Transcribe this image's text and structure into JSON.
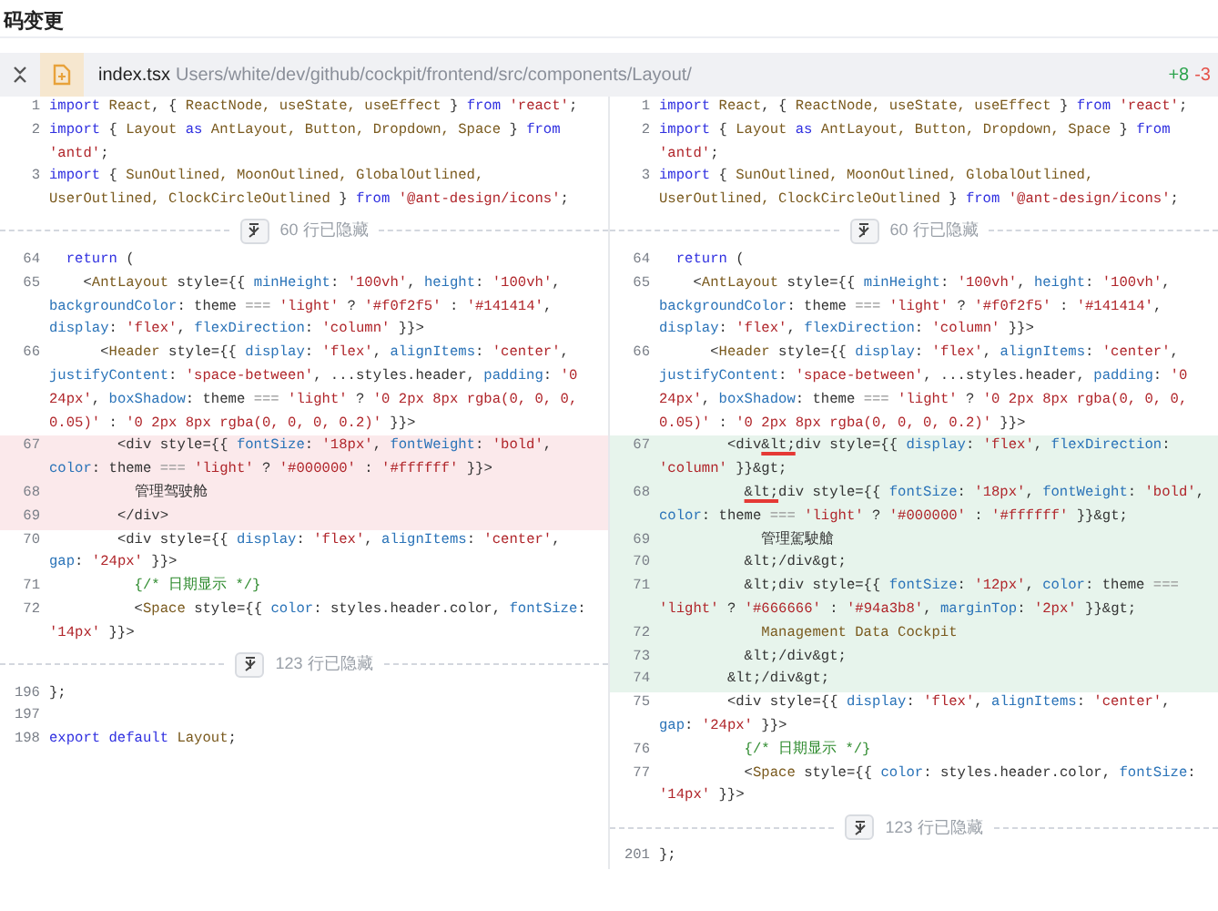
{
  "page_title": "码变更",
  "file": {
    "name": "index.tsx",
    "path": "Users/white/dev/github/cockpit/frontend/src/components/Layout/",
    "additions": "+8",
    "deletions": "-3"
  },
  "panes": [
    {
      "rows": [
        {
          "kind": "context",
          "number": "1",
          "segments": [
            {
              "kind": "kw",
              "text": "import "
            },
            {
              "kind": "type",
              "text": "React"
            },
            {
              "kind": "plain",
              "text": ", { "
            },
            {
              "kind": "type",
              "text": "ReactNode, useState, useEffect"
            },
            {
              "kind": "plain",
              "text": " } "
            },
            {
              "kind": "kw",
              "text": "from "
            },
            {
              "kind": "str",
              "text": "'react'"
            },
            {
              "kind": "plain",
              "text": ";"
            }
          ]
        },
        {
          "kind": "context",
          "number": "2",
          "segments": [
            {
              "kind": "kw",
              "text": "import"
            },
            {
              "kind": "plain",
              "text": " { "
            },
            {
              "kind": "type",
              "text": "Layout"
            },
            {
              "kind": "kw",
              "text": " as "
            },
            {
              "kind": "type",
              "text": "AntLayout, Button, Dropdown, Space"
            },
            {
              "kind": "plain",
              "text": " } "
            },
            {
              "kind": "kw",
              "text": "from "
            },
            {
              "kind": "str",
              "text": "'antd'"
            },
            {
              "kind": "plain",
              "text": ";"
            }
          ]
        },
        {
          "kind": "context",
          "number": "3",
          "segments": [
            {
              "kind": "kw",
              "text": "import"
            },
            {
              "kind": "plain",
              "text": " { "
            },
            {
              "kind": "type",
              "text": "SunOutlined, MoonOutlined, GlobalOutlined, UserOutlined, ClockCircleOutlined"
            },
            {
              "kind": "plain",
              "text": " } "
            },
            {
              "kind": "kw",
              "text": "from "
            },
            {
              "kind": "str",
              "text": "'@ant-design/icons'"
            },
            {
              "kind": "plain",
              "text": ";"
            }
          ]
        },
        {
          "kind": "fold",
          "text": "60 行已隐藏"
        },
        {
          "kind": "context",
          "number": "64",
          "segments": [
            {
              "kind": "kw",
              "text": "  return"
            },
            {
              "kind": "plain",
              "text": " ("
            }
          ]
        },
        {
          "kind": "context",
          "number": "65",
          "segments": [
            {
              "kind": "plain",
              "text": "    <"
            },
            {
              "kind": "type",
              "text": "AntLayout"
            },
            {
              "kind": "plain",
              "text": " style={{ "
            },
            {
              "kind": "prop",
              "text": "minHeight"
            },
            {
              "kind": "plain",
              "text": ": "
            },
            {
              "kind": "str",
              "text": "'100vh'"
            },
            {
              "kind": "plain",
              "text": ", "
            },
            {
              "kind": "prop",
              "text": "height"
            },
            {
              "kind": "plain",
              "text": ": "
            },
            {
              "kind": "str",
              "text": "'100vh'"
            },
            {
              "kind": "plain",
              "text": ", "
            },
            {
              "kind": "prop",
              "text": "backgroundColor"
            },
            {
              "kind": "plain",
              "text": ": theme "
            },
            {
              "kind": "op",
              "text": "=== "
            },
            {
              "kind": "str",
              "text": "'light'"
            },
            {
              "kind": "plain",
              "text": " ? "
            },
            {
              "kind": "str",
              "text": "'#f0f2f5'"
            },
            {
              "kind": "plain",
              "text": " : "
            },
            {
              "kind": "str",
              "text": "'#141414'"
            },
            {
              "kind": "plain",
              "text": ", "
            },
            {
              "kind": "prop",
              "text": "display"
            },
            {
              "kind": "plain",
              "text": ": "
            },
            {
              "kind": "str",
              "text": "'flex'"
            },
            {
              "kind": "plain",
              "text": ", "
            },
            {
              "kind": "prop",
              "text": "flexDirection"
            },
            {
              "kind": "plain",
              "text": ": "
            },
            {
              "kind": "str",
              "text": "'column'"
            },
            {
              "kind": "plain",
              "text": " }}>"
            }
          ]
        },
        {
          "kind": "context",
          "number": "66",
          "segments": [
            {
              "kind": "plain",
              "text": "      <"
            },
            {
              "kind": "type",
              "text": "Header"
            },
            {
              "kind": "plain",
              "text": " style={{ "
            },
            {
              "kind": "prop",
              "text": "display"
            },
            {
              "kind": "plain",
              "text": ": "
            },
            {
              "kind": "str",
              "text": "'flex'"
            },
            {
              "kind": "plain",
              "text": ", "
            },
            {
              "kind": "prop",
              "text": "alignItems"
            },
            {
              "kind": "plain",
              "text": ": "
            },
            {
              "kind": "str",
              "text": "'center'"
            },
            {
              "kind": "plain",
              "text": ", "
            },
            {
              "kind": "prop",
              "text": "justifyContent"
            },
            {
              "kind": "plain",
              "text": ": "
            },
            {
              "kind": "str",
              "text": "'space-between'"
            },
            {
              "kind": "plain",
              "text": ", ...styles.header, "
            },
            {
              "kind": "prop",
              "text": "padding"
            },
            {
              "kind": "plain",
              "text": ": "
            },
            {
              "kind": "str",
              "text": "'0 24px'"
            },
            {
              "kind": "plain",
              "text": ", "
            },
            {
              "kind": "prop",
              "text": "boxShadow"
            },
            {
              "kind": "plain",
              "text": ": theme "
            },
            {
              "kind": "op",
              "text": "=== "
            },
            {
              "kind": "str",
              "text": "'light'"
            },
            {
              "kind": "plain",
              "text": " ? "
            },
            {
              "kind": "str",
              "text": "'0 2px 8px rgba(0, 0, 0, 0.05)'"
            },
            {
              "kind": "plain",
              "text": " : "
            },
            {
              "kind": "str",
              "text": "'0 2px 8px rgba(0, 0, 0, 0.2)'"
            },
            {
              "kind": "plain",
              "text": " }}>"
            }
          ]
        },
        {
          "kind": "removed",
          "number": "67",
          "segments": [
            {
              "kind": "plain",
              "text": "        <div style={{ "
            },
            {
              "kind": "prop",
              "text": "fontSize"
            },
            {
              "kind": "plain",
              "text": ": "
            },
            {
              "kind": "str",
              "text": "'18px'"
            },
            {
              "kind": "plain",
              "text": ", "
            },
            {
              "kind": "prop",
              "text": "fontWeight"
            },
            {
              "kind": "plain",
              "text": ": "
            },
            {
              "kind": "str",
              "text": "'bold'"
            },
            {
              "kind": "plain",
              "text": ", "
            },
            {
              "kind": "prop",
              "text": "color"
            },
            {
              "kind": "plain",
              "text": ": theme "
            },
            {
              "kind": "op",
              "text": "=== "
            },
            {
              "kind": "str",
              "text": "'light'"
            },
            {
              "kind": "plain",
              "text": " ? "
            },
            {
              "kind": "str",
              "text": "'#000000'"
            },
            {
              "kind": "plain",
              "text": " : "
            },
            {
              "kind": "str",
              "text": "'#ffffff'"
            },
            {
              "kind": "plain",
              "text": " }}>"
            }
          ]
        },
        {
          "kind": "removed",
          "number": "68",
          "segments": [
            {
              "kind": "plain",
              "text": "          管理驾驶舱"
            }
          ]
        },
        {
          "kind": "removed",
          "number": "69",
          "segments": [
            {
              "kind": "plain",
              "text": "        </div>"
            }
          ]
        },
        {
          "kind": "context",
          "number": "70",
          "segments": [
            {
              "kind": "plain",
              "text": "        <div style={{ "
            },
            {
              "kind": "prop",
              "text": "display"
            },
            {
              "kind": "plain",
              "text": ": "
            },
            {
              "kind": "str",
              "text": "'flex'"
            },
            {
              "kind": "plain",
              "text": ", "
            },
            {
              "kind": "prop",
              "text": "alignItems"
            },
            {
              "kind": "plain",
              "text": ": "
            },
            {
              "kind": "str",
              "text": "'center'"
            },
            {
              "kind": "plain",
              "text": ", "
            },
            {
              "kind": "prop",
              "text": "gap"
            },
            {
              "kind": "plain",
              "text": ": "
            },
            {
              "kind": "str",
              "text": "'24px'"
            },
            {
              "kind": "plain",
              "text": " }}>"
            }
          ]
        },
        {
          "kind": "context",
          "number": "71",
          "segments": [
            {
              "kind": "comment",
              "text": "          {/* 日期显示 */}"
            }
          ]
        },
        {
          "kind": "context",
          "number": "72",
          "segments": [
            {
              "kind": "plain",
              "text": "          <"
            },
            {
              "kind": "type",
              "text": "Space"
            },
            {
              "kind": "plain",
              "text": " style={{ "
            },
            {
              "kind": "prop",
              "text": "color"
            },
            {
              "kind": "plain",
              "text": ": styles.header.color, "
            },
            {
              "kind": "prop",
              "text": "fontSize"
            },
            {
              "kind": "plain",
              "text": ": "
            },
            {
              "kind": "str",
              "text": "'14px'"
            },
            {
              "kind": "plain",
              "text": " }}>"
            }
          ]
        },
        {
          "kind": "fold",
          "text": "123 行已隐藏"
        },
        {
          "kind": "context",
          "number": "196",
          "segments": [
            {
              "kind": "plain",
              "text": "};"
            }
          ]
        },
        {
          "kind": "context",
          "number": "197"
        },
        {
          "kind": "context",
          "number": "198",
          "segments": [
            {
              "kind": "kw",
              "text": "export default "
            },
            {
              "kind": "type",
              "text": "Layout"
            },
            {
              "kind": "plain",
              "text": ";"
            }
          ]
        }
      ]
    },
    {
      "rows": [
        {
          "kind": "context",
          "number": "1",
          "segments": [
            {
              "kind": "kw",
              "text": "import "
            },
            {
              "kind": "type",
              "text": "React"
            },
            {
              "kind": "plain",
              "text": ", { "
            },
            {
              "kind": "type",
              "text": "ReactNode, useState, useEffect"
            },
            {
              "kind": "plain",
              "text": " } "
            },
            {
              "kind": "kw",
              "text": "from "
            },
            {
              "kind": "str",
              "text": "'react'"
            },
            {
              "kind": "plain",
              "text": ";"
            }
          ]
        },
        {
          "kind": "context",
          "number": "2",
          "segments": [
            {
              "kind": "kw",
              "text": "import"
            },
            {
              "kind": "plain",
              "text": " { "
            },
            {
              "kind": "type",
              "text": "Layout"
            },
            {
              "kind": "kw",
              "text": " as "
            },
            {
              "kind": "type",
              "text": "AntLayout, Button, Dropdown, Space"
            },
            {
              "kind": "plain",
              "text": " } "
            },
            {
              "kind": "kw",
              "text": "from "
            },
            {
              "kind": "str",
              "text": "'antd'"
            },
            {
              "kind": "plain",
              "text": ";"
            }
          ]
        },
        {
          "kind": "context",
          "number": "3",
          "segments": [
            {
              "kind": "kw",
              "text": "import"
            },
            {
              "kind": "plain",
              "text": " { "
            },
            {
              "kind": "type",
              "text": "SunOutlined, MoonOutlined, GlobalOutlined, UserOutlined, ClockCircleOutlined"
            },
            {
              "kind": "plain",
              "text": " } "
            },
            {
              "kind": "kw",
              "text": "from "
            },
            {
              "kind": "str",
              "text": "'@ant-design/icons'"
            },
            {
              "kind": "plain",
              "text": ";"
            }
          ]
        },
        {
          "kind": "fold",
          "text": "60 行已隐藏"
        },
        {
          "kind": "context",
          "number": "64",
          "segments": [
            {
              "kind": "kw",
              "text": "  return"
            },
            {
              "kind": "plain",
              "text": " ("
            }
          ]
        },
        {
          "kind": "context",
          "number": "65",
          "segments": [
            {
              "kind": "plain",
              "text": "    <"
            },
            {
              "kind": "type",
              "text": "AntLayout"
            },
            {
              "kind": "plain",
              "text": " style={{ "
            },
            {
              "kind": "prop",
              "text": "minHeight"
            },
            {
              "kind": "plain",
              "text": ": "
            },
            {
              "kind": "str",
              "text": "'100vh'"
            },
            {
              "kind": "plain",
              "text": ", "
            },
            {
              "kind": "prop",
              "text": "height"
            },
            {
              "kind": "plain",
              "text": ": "
            },
            {
              "kind": "str",
              "text": "'100vh'"
            },
            {
              "kind": "plain",
              "text": ", "
            },
            {
              "kind": "prop",
              "text": "backgroundColor"
            },
            {
              "kind": "plain",
              "text": ": theme "
            },
            {
              "kind": "op",
              "text": "=== "
            },
            {
              "kind": "str",
              "text": "'light'"
            },
            {
              "kind": "plain",
              "text": " ? "
            },
            {
              "kind": "str",
              "text": "'#f0f2f5'"
            },
            {
              "kind": "plain",
              "text": " : "
            },
            {
              "kind": "str",
              "text": "'#141414'"
            },
            {
              "kind": "plain",
              "text": ", "
            },
            {
              "kind": "prop",
              "text": "display"
            },
            {
              "kind": "plain",
              "text": ": "
            },
            {
              "kind": "str",
              "text": "'flex'"
            },
            {
              "kind": "plain",
              "text": ", "
            },
            {
              "kind": "prop",
              "text": "flexDirection"
            },
            {
              "kind": "plain",
              "text": ": "
            },
            {
              "kind": "str",
              "text": "'column'"
            },
            {
              "kind": "plain",
              "text": " }}>"
            }
          ]
        },
        {
          "kind": "context",
          "number": "66",
          "segments": [
            {
              "kind": "plain",
              "text": "      <"
            },
            {
              "kind": "type",
              "text": "Header"
            },
            {
              "kind": "plain",
              "text": " style={{ "
            },
            {
              "kind": "prop",
              "text": "display"
            },
            {
              "kind": "plain",
              "text": ": "
            },
            {
              "kind": "str",
              "text": "'flex'"
            },
            {
              "kind": "plain",
              "text": ", "
            },
            {
              "kind": "prop",
              "text": "alignItems"
            },
            {
              "kind": "plain",
              "text": ": "
            },
            {
              "kind": "str",
              "text": "'center'"
            },
            {
              "kind": "plain",
              "text": ", "
            },
            {
              "kind": "prop",
              "text": "justifyContent"
            },
            {
              "kind": "plain",
              "text": ": "
            },
            {
              "kind": "str",
              "text": "'space-between'"
            },
            {
              "kind": "plain",
              "text": ", ...styles.header, "
            },
            {
              "kind": "prop",
              "text": "padding"
            },
            {
              "kind": "plain",
              "text": ": "
            },
            {
              "kind": "str",
              "text": "'0 24px'"
            },
            {
              "kind": "plain",
              "text": ", "
            },
            {
              "kind": "prop",
              "text": "boxShadow"
            },
            {
              "kind": "plain",
              "text": ": theme "
            },
            {
              "kind": "op",
              "text": "=== "
            },
            {
              "kind": "str",
              "text": "'light'"
            },
            {
              "kind": "plain",
              "text": " ? "
            },
            {
              "kind": "str",
              "text": "'0 2px 8px rgba(0, 0, 0, 0.05)'"
            },
            {
              "kind": "plain",
              "text": " : "
            },
            {
              "kind": "str",
              "text": "'0 2px 8px rgba(0, 0, 0, 0.2)'"
            },
            {
              "kind": "plain",
              "text": " }}>"
            }
          ]
        },
        {
          "kind": "added",
          "number": "67",
          "segments": [
            {
              "kind": "plain",
              "text": "        <div"
            },
            {
              "kind": "flag",
              "text": "&lt;"
            },
            {
              "kind": "plain",
              "text": "div style={{ "
            },
            {
              "kind": "prop",
              "text": "display"
            },
            {
              "kind": "plain",
              "text": ": "
            },
            {
              "kind": "str",
              "text": "'flex'"
            },
            {
              "kind": "plain",
              "text": ", "
            },
            {
              "kind": "prop",
              "text": "flexDirection"
            },
            {
              "kind": "plain",
              "text": ": "
            },
            {
              "kind": "str",
              "text": "'column'"
            },
            {
              "kind": "plain",
              "text": " }}&gt;"
            }
          ]
        },
        {
          "kind": "added",
          "number": "68",
          "segments": [
            {
              "kind": "flag",
              "text": "          &lt;"
            },
            {
              "kind": "plain",
              "text": "div style={{ "
            },
            {
              "kind": "prop",
              "text": "fontSize"
            },
            {
              "kind": "plain",
              "text": ": "
            },
            {
              "kind": "str",
              "text": "'18px'"
            },
            {
              "kind": "plain",
              "text": ", "
            },
            {
              "kind": "prop",
              "text": "fontWeight"
            },
            {
              "kind": "plain",
              "text": ": "
            },
            {
              "kind": "str",
              "text": "'bold'"
            },
            {
              "kind": "plain",
              "text": ", "
            },
            {
              "kind": "prop",
              "text": "color"
            },
            {
              "kind": "plain",
              "text": ": theme "
            },
            {
              "kind": "op",
              "text": "=== "
            },
            {
              "kind": "str",
              "text": "'light'"
            },
            {
              "kind": "plain",
              "text": " ? "
            },
            {
              "kind": "str",
              "text": "'#000000'"
            },
            {
              "kind": "plain",
              "text": " : "
            },
            {
              "kind": "str",
              "text": "'#ffffff'"
            },
            {
              "kind": "plain",
              "text": " }}&gt;"
            }
          ]
        },
        {
          "kind": "added",
          "number": "69",
          "segments": [
            {
              "kind": "plain",
              "text": "            管理駕駛艙"
            }
          ]
        },
        {
          "kind": "added",
          "number": "70",
          "segments": [
            {
              "kind": "plain",
              "text": "          &lt;/div&gt;"
            }
          ]
        },
        {
          "kind": "added",
          "number": "71",
          "segments": [
            {
              "kind": "plain",
              "text": "          &lt;div style={{ "
            },
            {
              "kind": "prop",
              "text": "fontSize"
            },
            {
              "kind": "plain",
              "text": ": "
            },
            {
              "kind": "str",
              "text": "'12px'"
            },
            {
              "kind": "plain",
              "text": ", "
            },
            {
              "kind": "prop",
              "text": "color"
            },
            {
              "kind": "plain",
              "text": ": theme "
            },
            {
              "kind": "op",
              "text": "=== "
            },
            {
              "kind": "str",
              "text": "'light'"
            },
            {
              "kind": "plain",
              "text": " ? "
            },
            {
              "kind": "str",
              "text": "'#666666'"
            },
            {
              "kind": "plain",
              "text": " : "
            },
            {
              "kind": "str",
              "text": "'#94a3b8'"
            },
            {
              "kind": "plain",
              "text": ", "
            },
            {
              "kind": "prop",
              "text": "marginTop"
            },
            {
              "kind": "plain",
              "text": ": "
            },
            {
              "kind": "str",
              "text": "'2px'"
            },
            {
              "kind": "plain",
              "text": " }}&gt;"
            }
          ]
        },
        {
          "kind": "added",
          "number": "72",
          "segments": [
            {
              "kind": "type",
              "text": "            Management Data Cockpit"
            }
          ]
        },
        {
          "kind": "added",
          "number": "73",
          "segments": [
            {
              "kind": "plain",
              "text": "          &lt;/div&gt;"
            }
          ]
        },
        {
          "kind": "added",
          "number": "74",
          "segments": [
            {
              "kind": "plain",
              "text": "        &lt;/div&gt;"
            }
          ]
        },
        {
          "kind": "context",
          "number": "75",
          "segments": [
            {
              "kind": "plain",
              "text": "        <div style={{ "
            },
            {
              "kind": "prop",
              "text": "display"
            },
            {
              "kind": "plain",
              "text": ": "
            },
            {
              "kind": "str",
              "text": "'flex'"
            },
            {
              "kind": "plain",
              "text": ", "
            },
            {
              "kind": "prop",
              "text": "alignItems"
            },
            {
              "kind": "plain",
              "text": ": "
            },
            {
              "kind": "str",
              "text": "'center'"
            },
            {
              "kind": "plain",
              "text": ", "
            },
            {
              "kind": "prop",
              "text": "gap"
            },
            {
              "kind": "plain",
              "text": ": "
            },
            {
              "kind": "str",
              "text": "'24px'"
            },
            {
              "kind": "plain",
              "text": " }}>"
            }
          ]
        },
        {
          "kind": "context",
          "number": "76",
          "segments": [
            {
              "kind": "comment",
              "text": "          {/* 日期显示 */}"
            }
          ]
        },
        {
          "kind": "context",
          "number": "77",
          "segments": [
            {
              "kind": "plain",
              "text": "          <"
            },
            {
              "kind": "type",
              "text": "Space"
            },
            {
              "kind": "plain",
              "text": " style={{ "
            },
            {
              "kind": "prop",
              "text": "color"
            },
            {
              "kind": "plain",
              "text": ": styles.header.color, "
            },
            {
              "kind": "prop",
              "text": "fontSize"
            },
            {
              "kind": "plain",
              "text": ": "
            },
            {
              "kind": "str",
              "text": "'14px'"
            },
            {
              "kind": "plain",
              "text": " }}>"
            }
          ]
        },
        {
          "kind": "fold",
          "text": "123 行已隐藏"
        },
        {
          "kind": "context",
          "number": "201",
          "segments": [
            {
              "kind": "plain",
              "text": "};"
            }
          ]
        }
      ]
    }
  ]
}
